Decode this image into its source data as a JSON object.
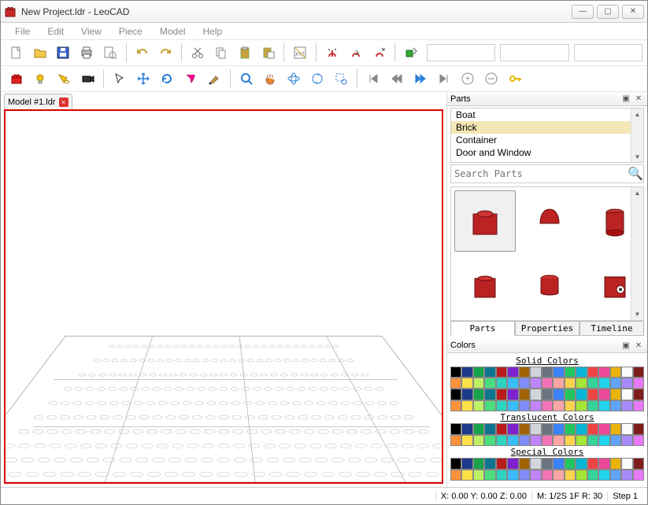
{
  "window": {
    "title": "New Project.ldr - LeoCAD"
  },
  "menu": {
    "items": [
      "File",
      "Edit",
      "View",
      "Piece",
      "Model",
      "Help"
    ]
  },
  "toolbar1": [
    {
      "name": "new-file-icon",
      "color": "#fff",
      "stroke": "#888"
    },
    {
      "name": "open-file-icon",
      "color": "#f5c84a"
    },
    {
      "name": "save-icon",
      "color": "#3a66d6"
    },
    {
      "name": "print-icon",
      "color": "#888"
    },
    {
      "name": "print-preview-icon",
      "color": "#888"
    },
    {
      "sep": true
    },
    {
      "name": "undo-icon",
      "color": "#c9a13a"
    },
    {
      "name": "redo-icon",
      "color": "#c9a13a"
    },
    {
      "sep": true
    },
    {
      "name": "cut-icon",
      "color": "#888"
    },
    {
      "name": "copy-icon",
      "color": "#888"
    },
    {
      "name": "paste-icon",
      "color": "#c9a13a"
    },
    {
      "name": "paste-special-icon",
      "color": "#c9a13a"
    },
    {
      "sep": true
    },
    {
      "name": "transform-xyz-icon",
      "color": "#da3"
    },
    {
      "sep": true
    },
    {
      "name": "snap-move-icon",
      "color": "#c33"
    },
    {
      "name": "snap-rotate-icon",
      "color": "#c33"
    },
    {
      "name": "snap-scale-icon",
      "color": "#c33"
    },
    {
      "sep": true
    },
    {
      "name": "relative-transform-icon",
      "color": "#3a3"
    }
  ],
  "toolbar2": [
    {
      "name": "brick-icon",
      "color": "#d22"
    },
    {
      "name": "light-icon",
      "color": "#f5c21a"
    },
    {
      "name": "spotlight-icon",
      "color": "#f5c21a"
    },
    {
      "name": "camera-icon",
      "color": "#333"
    },
    {
      "sep": true
    },
    {
      "name": "select-tool-icon",
      "color": "#555"
    },
    {
      "name": "move-tool-icon",
      "color": "#2b7fd6"
    },
    {
      "name": "rotate-tool-icon",
      "color": "#2b7fd6"
    },
    {
      "name": "delete-tool-icon",
      "color": "#f08"
    },
    {
      "name": "paint-tool-icon",
      "color": "#c9a13a"
    },
    {
      "sep": true
    },
    {
      "name": "zoom-tool-icon",
      "color": "#2b7fd6"
    },
    {
      "name": "pan-tool-icon",
      "color": "#e58a2a"
    },
    {
      "name": "orbit-tool-icon",
      "color": "#2b7fd6"
    },
    {
      "name": "roll-tool-icon",
      "color": "#2b7fd6"
    },
    {
      "name": "zoom-region-icon",
      "color": "#2b7fd6"
    },
    {
      "sep": true
    },
    {
      "name": "first-step-icon",
      "color": "#888"
    },
    {
      "name": "prev-step-icon",
      "color": "#888"
    },
    {
      "name": "next-step-icon",
      "color": "#2b7fd6"
    },
    {
      "name": "last-step-icon",
      "color": "#888"
    },
    {
      "name": "insert-step-icon",
      "color": "#888"
    },
    {
      "name": "remove-step-icon",
      "color": "#888"
    },
    {
      "name": "key-icon",
      "color": "#e6b800"
    }
  ],
  "doc_tab": {
    "label": "Model #1.ldr"
  },
  "parts_panel": {
    "title": "Parts",
    "categories": [
      "Boat",
      "Brick",
      "Container",
      "Door and Window"
    ],
    "selected": 1,
    "search_placeholder": "Search Parts",
    "subtabs": [
      "Parts",
      "Properties",
      "Timeline"
    ],
    "active_subtab": 0
  },
  "colors_panel": {
    "title": "Colors",
    "sections": [
      {
        "label": "Solid Colors",
        "rows": 4
      },
      {
        "label": "Translucent Colors",
        "rows": 2
      },
      {
        "label": "Special Colors",
        "rows": 2
      }
    ],
    "palette": [
      "#000",
      "#1e3a8a",
      "#16a34a",
      "#0e7490",
      "#b91c1c",
      "#7e22ce",
      "#a16207",
      "#d1d5db",
      "#6b7280",
      "#3b82f6",
      "#22c55e",
      "#06b6d4",
      "#ef4444",
      "#ec4899",
      "#eab308",
      "#f8fafc",
      "#7f1d1d",
      "#fb923c",
      "#fde047",
      "#bef264",
      "#4ade80",
      "#2dd4bf",
      "#38bdf8",
      "#818cf8",
      "#c084fc",
      "#f472b6",
      "#fca5a5",
      "#fcd34d",
      "#a3e635",
      "#34d399",
      "#22d3ee",
      "#60a5fa",
      "#a78bfa",
      "#e879f9"
    ]
  },
  "status": {
    "coords": "X: 0.00 Y: 0.00 Z: 0.00",
    "snap": "M: 1/2S 1F R: 30",
    "step": "Step 1"
  }
}
